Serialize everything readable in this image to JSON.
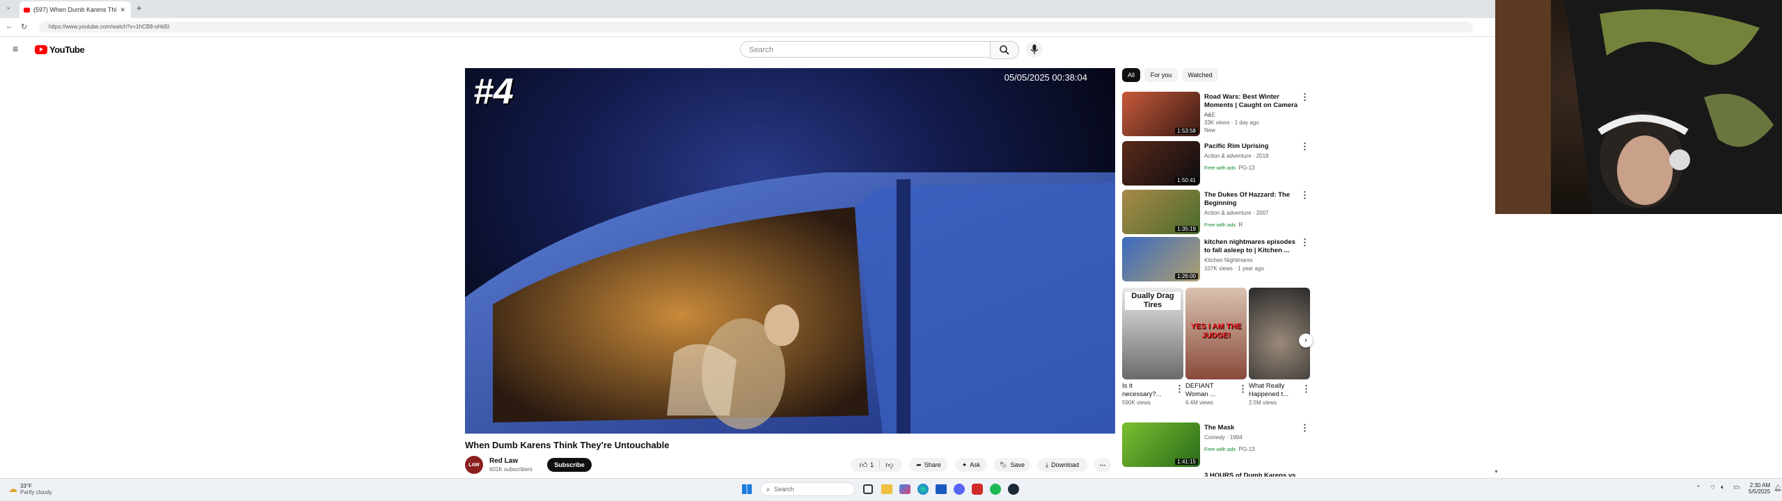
{
  "browser": {
    "tab_title": "(597) When Dumb Karens Thi",
    "url": "https://www.youtube.com/watch?v=1hCB8-oHd5I"
  },
  "header": {
    "logo_text": "YouTube",
    "search_placeholder": "Search"
  },
  "video": {
    "overlay_rank": "#4",
    "timestamp": "05/05/2025 00:38:04",
    "title": "When Dumb Karens Think They're Untouchable",
    "channel_name": "Red Law",
    "channel_avatar_text": "LAW",
    "subscribers": "601K subscribers",
    "subscribe_label": "Subscribe",
    "likes": "1",
    "share_label": "Share",
    "ask_label": "Ask",
    "save_label": "Save",
    "download_label": "Download"
  },
  "sidebar": {
    "chips": [
      "All",
      "For you",
      "Watched"
    ],
    "items": [
      {
        "title": "Road Wars: Best Winter Moments | Caught on Camera ...",
        "meta1": "A&E",
        "meta2": "33K views · 1 day ago",
        "meta3": "New",
        "duration": "1:53:58",
        "color": "#8a3a2a"
      },
      {
        "title": "Pacific Rim Uprising",
        "meta1": "Action & adventure · 2018",
        "meta2": "Free with ads",
        "meta3": "PG-13",
        "duration": "1:50:41",
        "color": "#2a1a1a"
      },
      {
        "title": "The Dukes Of Hazzard: The Beginning",
        "meta1": "Action & adventure · 2007",
        "meta2": "Free with ads",
        "meta3": "R",
        "duration": "1:35:19",
        "color": "#7a6a3a"
      },
      {
        "title": "kitchen nightmares episodes to fall asleep to | Kitchen ...",
        "meta1": "Kitchen Nightmares",
        "meta2": "107K views · 1 year ago",
        "meta3": "",
        "duration": "1:26:00",
        "color": "#2a4a8a"
      }
    ],
    "shorts": [
      {
        "overlay": "Dually Drag Tires",
        "title": "Is it necessary?...",
        "views": "590K views"
      },
      {
        "overlay": "YES I AM THE JUDGE!",
        "title": "DEFIANT Woman ...",
        "views": "6.4M views"
      },
      {
        "overlay": "",
        "title": "What Really Happened t...",
        "views": "2.5M views"
      }
    ],
    "last_item": {
      "title": "The Mask",
      "meta1": "Comedy · 1994",
      "meta2": "Free with ads",
      "meta3": "PG-13",
      "duration": "1:41:15"
    },
    "partial_item_title": "3 HOURS of Dumb Karens vs ..."
  },
  "taskbar": {
    "weather_temp": "33°F",
    "weather_desc": "Partly cloudy",
    "search_label": "Search",
    "clock_time": "2:30 AM",
    "clock_date": "5/5/2025"
  }
}
